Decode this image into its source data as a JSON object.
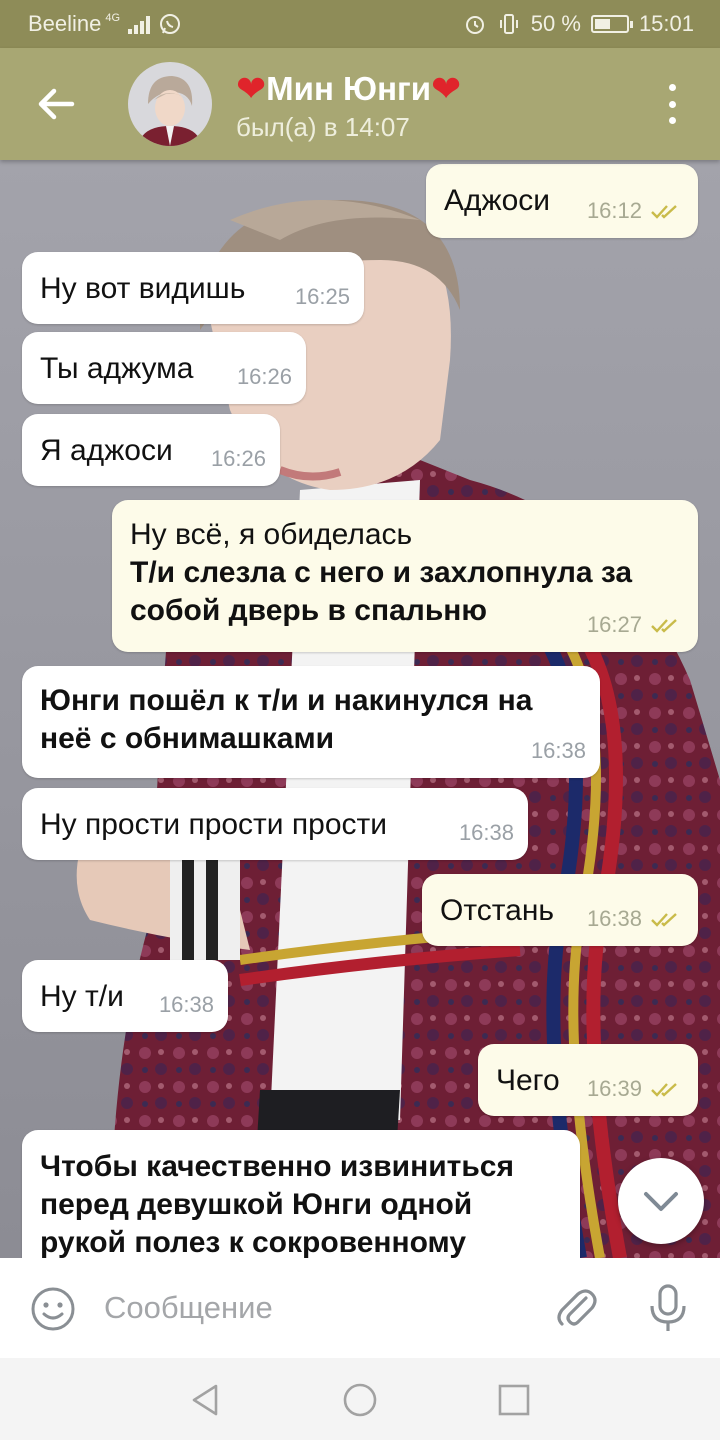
{
  "status_bar": {
    "carrier": "Beeline",
    "network": "4G",
    "battery": "50 %",
    "battery_level": 0.5,
    "time": "15:01"
  },
  "header": {
    "title": "Мин Юнги",
    "heart": "❤",
    "status": "был(а) в 14:07"
  },
  "messages": [
    {
      "dir": "out",
      "text": "Аджоси",
      "time": "16:12"
    },
    {
      "dir": "in",
      "text": "Ну вот видишь",
      "time": "16:25"
    },
    {
      "dir": "in",
      "text": "Ты аджума",
      "time": "16:26"
    },
    {
      "dir": "in",
      "text": "Я аджоси",
      "time": "16:26"
    },
    {
      "dir": "out",
      "line1": "Ну всё, я обиделась",
      "bold1": "Т/и слезла с него и захлопнула за",
      "bold2": "собой дверь в спальню",
      "time": "16:27"
    },
    {
      "dir": "in",
      "bold1": "Юнги пошёл к т/и и накинулся на",
      "bold2": "неё с обнимашками",
      "time": "16:38"
    },
    {
      "dir": "in",
      "text": "Ну прости прости прости",
      "time": "16:38"
    },
    {
      "dir": "out",
      "text": "Отстань",
      "time": "16:38"
    },
    {
      "dir": "in",
      "text": "Ну т/и",
      "time": "16:38"
    },
    {
      "dir": "out",
      "text": "Чего",
      "time": "16:39"
    },
    {
      "dir": "in",
      "bold1": "Чтобы качественно извиниться",
      "bold2": "перед девушкой Юнги одной",
      "bold3": "рукой полез к сокровенному"
    }
  ],
  "input": {
    "placeholder": "Сообщение"
  },
  "colors": {
    "header": "#a8a773",
    "status_bar": "#8e8c58",
    "outgoing_bubble": "#fdfbe9",
    "incoming_bubble": "#ffffff",
    "read_ticks": "#c9bb4a"
  },
  "icons": [
    "back-arrow-icon",
    "avatar",
    "more-vert-icon",
    "double-check-icon",
    "chevron-down-icon",
    "emoji-icon",
    "paperclip-icon",
    "microphone-icon",
    "nav-back-icon",
    "nav-home-icon",
    "nav-recents-icon"
  ]
}
